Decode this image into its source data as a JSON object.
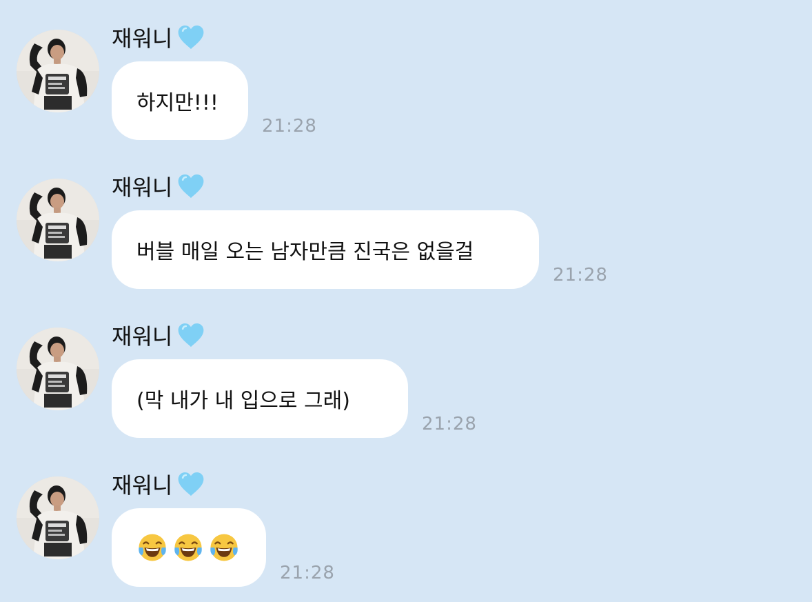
{
  "messages": [
    {
      "sender": "재워니",
      "text": "하지만!!!",
      "time": "21:28"
    },
    {
      "sender": "재워니",
      "text": "버블 매일 오는 남자만큼 진국은 없을걸",
      "time": "21:28"
    },
    {
      "sender": "재워니",
      "text": "(막 내가 내 입으로 그래)",
      "time": "21:28"
    },
    {
      "sender": "재워니",
      "emojis": [
        "😂",
        "😂",
        "😂"
      ],
      "time": "21:28"
    }
  ],
  "icons": {
    "sender_badge": "light-blue-heart-icon",
    "reaction": "face-with-tears-of-joy-icon"
  },
  "colors": {
    "background": "#d6e6f5",
    "bubble": "#ffffff",
    "timestamp": "#9aa3ad",
    "heart": "#7fd0f5"
  }
}
